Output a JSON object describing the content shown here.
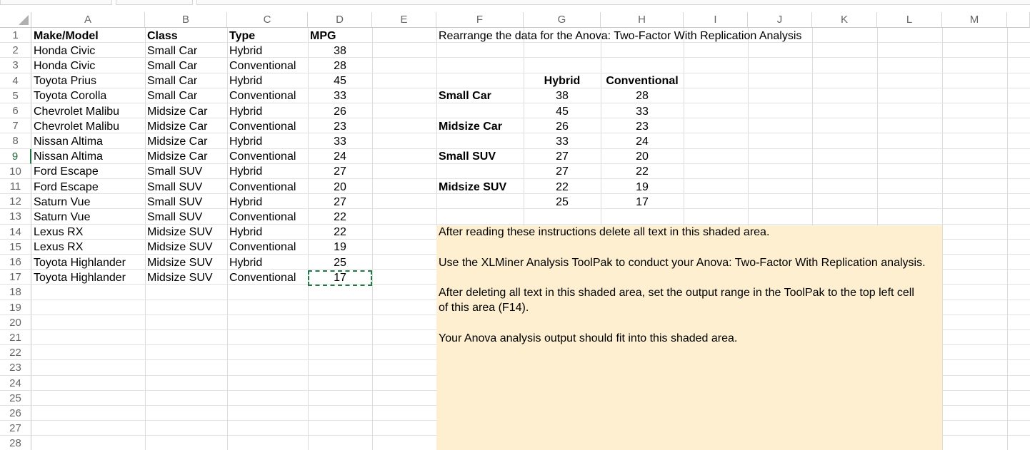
{
  "columns": [
    "A",
    "B",
    "C",
    "D",
    "E",
    "F",
    "G",
    "H",
    "I",
    "J",
    "K",
    "L",
    "M"
  ],
  "rows": [
    "1",
    "2",
    "3",
    "4",
    "5",
    "6",
    "7",
    "8",
    "9",
    "10",
    "11",
    "12",
    "13",
    "14",
    "15",
    "16",
    "17",
    "18",
    "19",
    "20",
    "21",
    "22",
    "23",
    "24",
    "25",
    "26",
    "27",
    "28"
  ],
  "selected_row": "9",
  "table": {
    "headers": [
      "Make/Model",
      "Class",
      "Type",
      "MPG"
    ],
    "rows": [
      [
        "Honda Civic",
        "Small Car",
        "Hybrid",
        "38"
      ],
      [
        "Honda Civic",
        "Small Car",
        "Conventional",
        "28"
      ],
      [
        "Toyota Prius",
        "Small Car",
        "Hybrid",
        "45"
      ],
      [
        "Toyota Corolla",
        "Small Car",
        "Conventional",
        "33"
      ],
      [
        "Chevrolet Malibu",
        "Midsize Car",
        "Hybrid",
        "26"
      ],
      [
        "Chevrolet Malibu",
        "Midsize Car",
        "Conventional",
        "23"
      ],
      [
        "Nissan Altima",
        "Midsize Car",
        "Hybrid",
        "33"
      ],
      [
        "Nissan Altima",
        "Midsize Car",
        "Conventional",
        "24"
      ],
      [
        "Ford Escape",
        "Small SUV",
        "Hybrid",
        "27"
      ],
      [
        "Ford Escape",
        "Small SUV",
        "Conventional",
        "20"
      ],
      [
        "Saturn Vue",
        "Small SUV",
        "Hybrid",
        "27"
      ],
      [
        "Saturn Vue",
        "Small SUV",
        "Conventional",
        "22"
      ],
      [
        "Lexus RX",
        "Midsize SUV",
        "Hybrid",
        "22"
      ],
      [
        "Lexus RX",
        "Midsize SUV",
        "Conventional",
        "19"
      ],
      [
        "Toyota Highlander",
        "Midsize SUV",
        "Hybrid",
        "25"
      ],
      [
        "Toyota Highlander",
        "Midsize SUV",
        "Conventional",
        "17"
      ]
    ]
  },
  "rearranged": {
    "title": "Rearrange the data for the Anova: Two-Factor With Replication Analysis",
    "headers": [
      "Hybrid",
      "Conventional"
    ],
    "groups": [
      {
        "label": "Small Car",
        "rows": [
          [
            "38",
            "28"
          ],
          [
            "45",
            "33"
          ]
        ]
      },
      {
        "label": "Midsize Car",
        "rows": [
          [
            "26",
            "23"
          ],
          [
            "33",
            "24"
          ]
        ]
      },
      {
        "label": "Small SUV",
        "rows": [
          [
            "27",
            "20"
          ],
          [
            "27",
            "22"
          ]
        ]
      },
      {
        "label": "Midsize SUV",
        "rows": [
          [
            "22",
            "19"
          ],
          [
            "25",
            "17"
          ]
        ]
      }
    ]
  },
  "instructions": {
    "line1": "After reading these instructions delete all text in this shaded area.",
    "line2": "Use the XLMiner Analysis ToolPak to conduct your Anova: Two-Factor With Replication analysis.",
    "line3a": "After deleting all text in this shaded area, set the output range in the ToolPak to the top left cell",
    "line3b": "of this area (F14).",
    "line4": "Your Anova analysis output should fit into this shaded area."
  },
  "colors": {
    "shade": "#fdefd0",
    "selection": "#217346"
  }
}
